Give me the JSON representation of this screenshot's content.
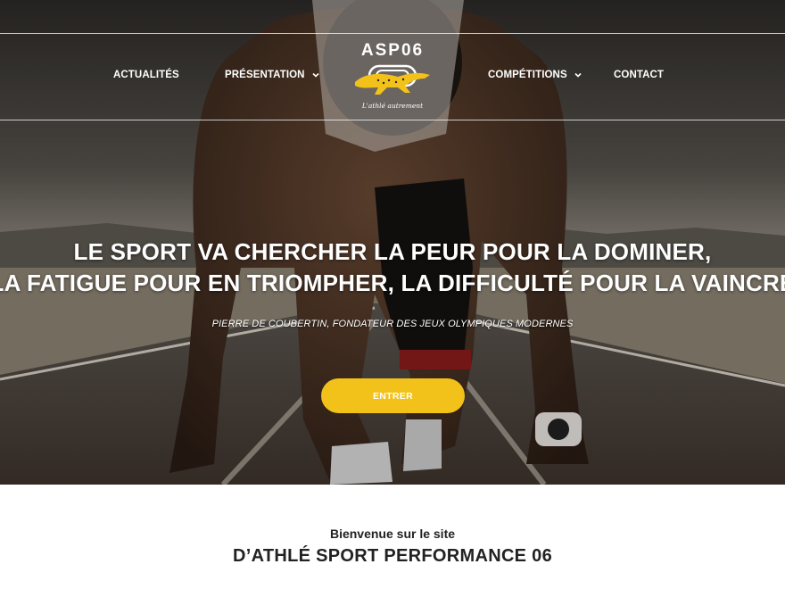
{
  "nav": {
    "items": [
      {
        "label": "ACTUALITÉS",
        "has_dropdown": false
      },
      {
        "label": "PRÉSENTATION",
        "has_dropdown": true
      },
      {
        "label": "COMPÉTITIONS",
        "has_dropdown": true
      },
      {
        "label": "CONTACT",
        "has_dropdown": false
      }
    ]
  },
  "logo": {
    "name": "ASP06",
    "tagline": "L'athlé autrement",
    "icon": "cheetah-logo-icon",
    "accent": "#f2c21b"
  },
  "hero": {
    "headline_line1": "LE SPORT VA CHERCHER LA PEUR POUR LA DOMINER,",
    "headline_line2": "LA FATIGUE POUR EN TRIOMPHER, LA DIFFICULTÉ POUR LA VAINCRE",
    "quote_author": "PIERRE DE COUBERTIN, FONDATEUR DES JEUX OLYMPIQUES MODERNES",
    "cta_label": "ENTRER",
    "cta_color": "#f2c21b"
  },
  "intro": {
    "welcome": "Bienvenue sur le site",
    "title": "D’ATHLÉ SPORT PERFORMANCE 06"
  }
}
